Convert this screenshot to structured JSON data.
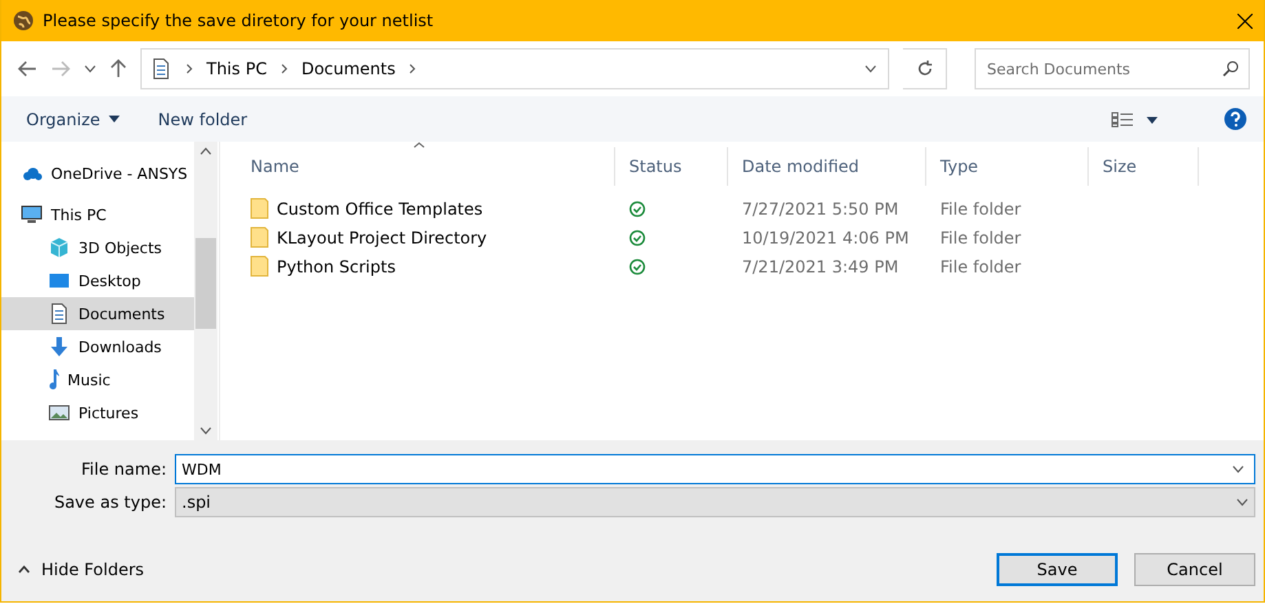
{
  "window": {
    "title": "Please specify the save diretory for your netlist"
  },
  "address": {
    "crumbs": [
      "This PC",
      "Documents"
    ]
  },
  "search": {
    "placeholder": "Search Documents"
  },
  "toolbar": {
    "organize": "Organize",
    "new_folder": "New folder"
  },
  "sidebar": {
    "items": [
      {
        "label": "OneDrive - ANSYS",
        "kind": "cloud",
        "selected": false
      },
      {
        "label": "This PC",
        "kind": "pc",
        "selected": false,
        "children": [
          {
            "label": "3D Objects",
            "kind": "cube",
            "selected": false
          },
          {
            "label": "Desktop",
            "kind": "desktop",
            "selected": false
          },
          {
            "label": "Documents",
            "kind": "document",
            "selected": true
          },
          {
            "label": "Downloads",
            "kind": "download",
            "selected": false
          },
          {
            "label": "Music",
            "kind": "music",
            "selected": false
          },
          {
            "label": "Pictures",
            "kind": "picture",
            "selected": false
          }
        ]
      }
    ]
  },
  "table": {
    "columns": [
      "Name",
      "Status",
      "Date modified",
      "Type",
      "Size"
    ],
    "rows": [
      {
        "name": "Custom Office Templates",
        "date": "7/27/2021 5:50 PM",
        "type": "File folder"
      },
      {
        "name": "KLayout Project Directory",
        "date": "10/19/2021 4:06 PM",
        "type": "File folder"
      },
      {
        "name": "Python Scripts",
        "date": "7/21/2021 3:49 PM",
        "type": "File folder"
      }
    ]
  },
  "form": {
    "file_name_label": "File name:",
    "file_name": "WDM",
    "type_label": "Save as type:",
    "type": ".spi"
  },
  "footer": {
    "hide_folders": "Hide Folders",
    "buttons": [
      "Save",
      "Cancel"
    ]
  }
}
